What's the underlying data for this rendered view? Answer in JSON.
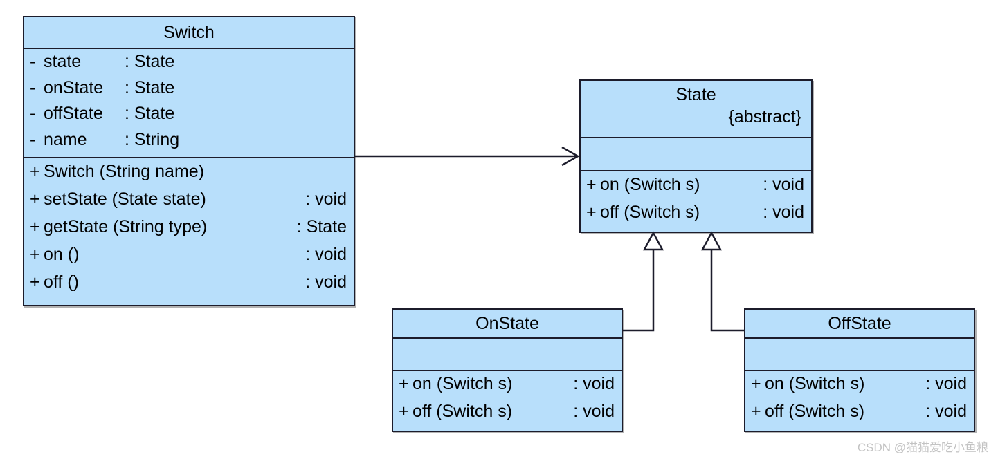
{
  "diagram": {
    "type": "uml-class-diagram",
    "title": "State Pattern Switch Class Diagram",
    "fill_color": "#b8dffb",
    "border_color": "#1c1c2b",
    "background_color": "#ffffff"
  },
  "classes": {
    "switch": {
      "name": "Switch",
      "attributes": [
        {
          "visibility": "-",
          "signature": "state",
          "type": ": State"
        },
        {
          "visibility": "-",
          "signature": "onState",
          "type": ": State"
        },
        {
          "visibility": "-",
          "signature": "offState",
          "type": ": State"
        },
        {
          "visibility": "-",
          "signature": "name",
          "type": ": String"
        }
      ],
      "methods": [
        {
          "visibility": "+",
          "signature": "Switch (String name)",
          "type": ""
        },
        {
          "visibility": "+",
          "signature": "setState (State state)",
          "type": ": void"
        },
        {
          "visibility": "+",
          "signature": "getState (String type)",
          "type": ": State"
        },
        {
          "visibility": "+",
          "signature": "on ()",
          "type": ": void"
        },
        {
          "visibility": "+",
          "signature": "off ()",
          "type": ": void"
        }
      ]
    },
    "state": {
      "name": "State",
      "stereotype": "{abstract}",
      "attributes": [],
      "methods": [
        {
          "visibility": "+",
          "signature": "on (Switch s)",
          "type": ": void"
        },
        {
          "visibility": "+",
          "signature": "off (Switch s)",
          "type": ": void"
        }
      ]
    },
    "onstate": {
      "name": "OnState",
      "attributes": [],
      "methods": [
        {
          "visibility": "+",
          "signature": "on (Switch s)",
          "type": ": void"
        },
        {
          "visibility": "+",
          "signature": "off (Switch s)",
          "type": ": void"
        }
      ]
    },
    "offstate": {
      "name": "OffState",
      "attributes": [],
      "methods": [
        {
          "visibility": "+",
          "signature": "on (Switch s)",
          "type": ": void"
        },
        {
          "visibility": "+",
          "signature": "off (Switch s)",
          "type": ": void"
        }
      ]
    }
  },
  "relationships": [
    {
      "id": "switch-to-state",
      "kind": "association",
      "from": "Switch",
      "to": "State",
      "arrow": "open-arrow"
    },
    {
      "id": "onstate-to-state",
      "kind": "generalization",
      "from": "OnState",
      "to": "State",
      "arrow": "hollow-triangle"
    },
    {
      "id": "offstate-to-state",
      "kind": "generalization",
      "from": "OffState",
      "to": "State",
      "arrow": "hollow-triangle"
    }
  ],
  "watermark": {
    "text": "CSDN @猫猫爱吃小鱼粮"
  }
}
